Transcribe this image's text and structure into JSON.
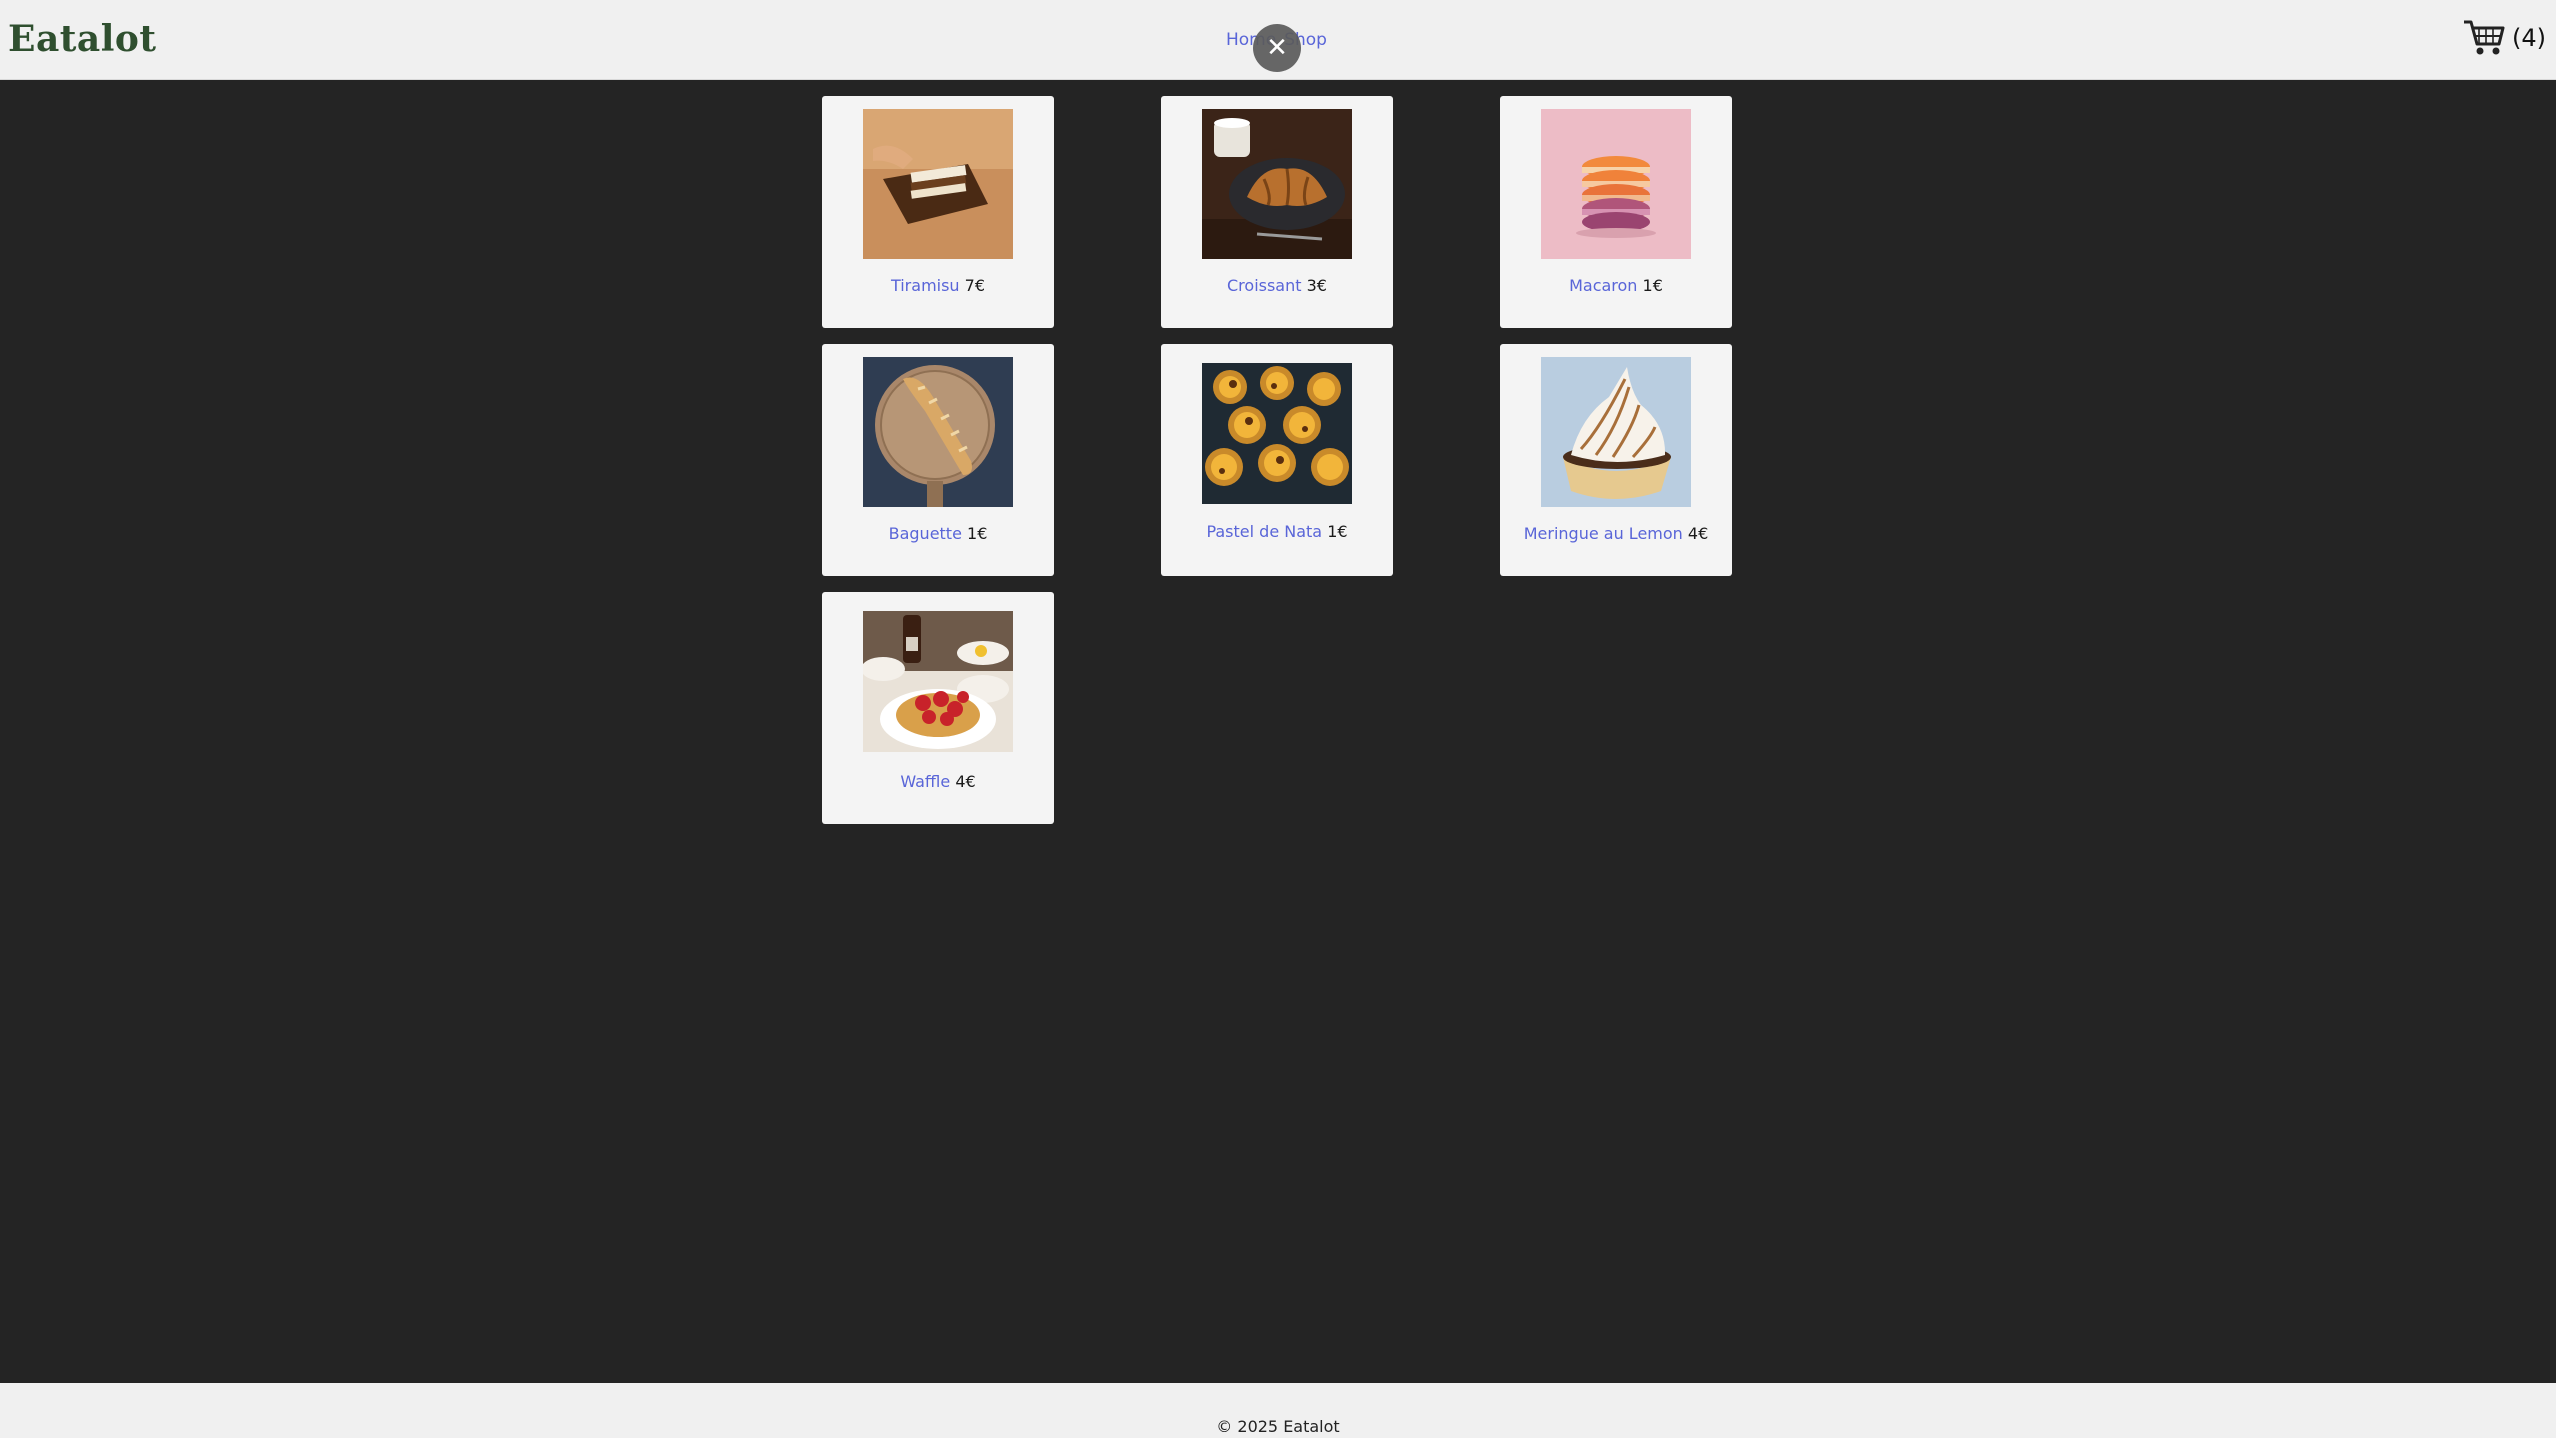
{
  "brand": {
    "name": "Eatalot",
    "color": "#2f4f2f"
  },
  "nav": {
    "home": "Home",
    "shop": "Shop"
  },
  "overlay": {
    "close_symbol": "✕"
  },
  "cart": {
    "count_label": "(4)",
    "icon": "cart-icon"
  },
  "products": [
    {
      "name": "Tiramisu",
      "price": "7€",
      "icon": "tiramisu-image"
    },
    {
      "name": "Croissant",
      "price": "3€",
      "icon": "croissant-image"
    },
    {
      "name": "Macaron",
      "price": "1€",
      "icon": "macaron-image"
    },
    {
      "name": "Baguette",
      "price": "1€",
      "icon": "baguette-image"
    },
    {
      "name": "Pastel de Nata",
      "price": "1€",
      "icon": "pastel-de-nata-image"
    },
    {
      "name": "Meringue au Lemon",
      "price": "4€",
      "icon": "meringue-image"
    },
    {
      "name": "Waffle",
      "price": "4€",
      "icon": "waffle-image"
    }
  ],
  "footer": {
    "text": "© 2025 Eatalot"
  },
  "colors": {
    "link": "#5965d8",
    "background": "#242424",
    "card": "#f4f4f4"
  }
}
